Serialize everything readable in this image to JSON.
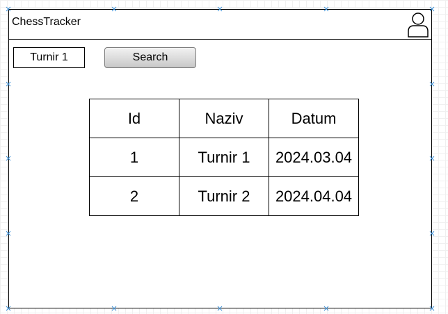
{
  "app": {
    "title": "ChessTracker"
  },
  "header": {
    "user_icon": "user-icon"
  },
  "search": {
    "value": "Turnir 1",
    "button_label": "Search"
  },
  "table": {
    "columns": [
      "Id",
      "Naziv",
      "Datum"
    ],
    "rows": [
      [
        "1",
        "Turnir 1",
        "2024.03.04"
      ],
      [
        "2",
        "Turnir 2",
        "2024.04.04"
      ]
    ]
  }
}
